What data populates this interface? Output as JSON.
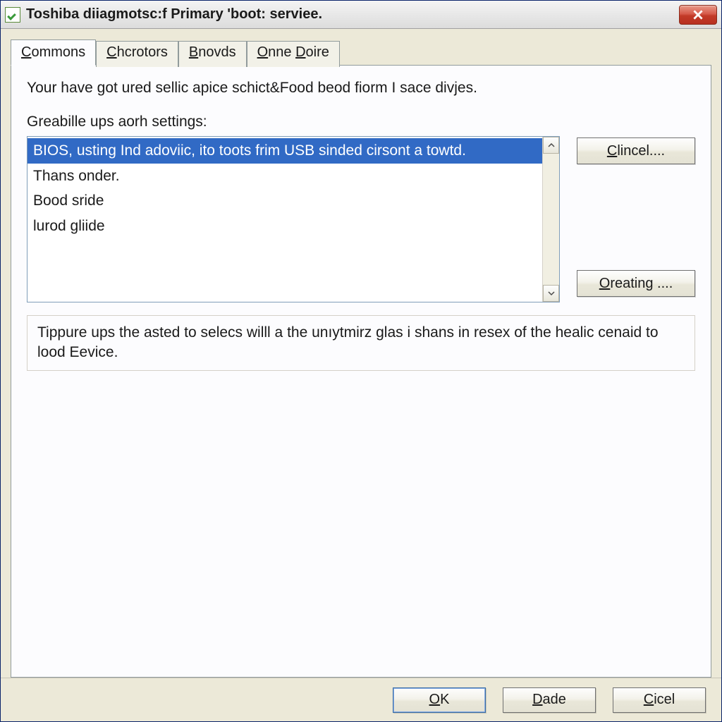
{
  "window": {
    "title": "Toshiba diiagmotsc:f Primary 'boot: serviee."
  },
  "tabs": [
    {
      "label_pre": "C",
      "label_rest": "ommons"
    },
    {
      "label_pre": "C",
      "label_rest": "hcrotors"
    },
    {
      "label_pre": "B",
      "label_rest": "novds"
    },
    {
      "label_pre": "O",
      "label_rest": "nne ",
      "label_pre2": "D",
      "label_rest2": "oire"
    }
  ],
  "panel": {
    "intro": "Your have got ured sellic apice schict&Food beod fiorm I sace divjes.",
    "list_label": "Greabille ups aorh settings:",
    "items": [
      "BIOS, usting Ind adoviic, ito toots frim USB sinded cirsont a towtd.",
      "Thans onder.",
      "Bood sride",
      "lurod gliide"
    ],
    "hint": "Tippure ups the asted to selecs willl a the unıytmirz glas i shans in resex of the healic cenaid to lood Eevice."
  },
  "side_buttons": {
    "cancel": {
      "pre": "C",
      "rest": "lincel...."
    },
    "creating": {
      "pre": "O",
      "rest": "reating ...."
    }
  },
  "footer": {
    "ok": {
      "pre": "O",
      "rest": "K"
    },
    "dade": {
      "pre": "D",
      "rest": "ade"
    },
    "cicel": {
      "pre": "C",
      "rest": "icel"
    }
  }
}
